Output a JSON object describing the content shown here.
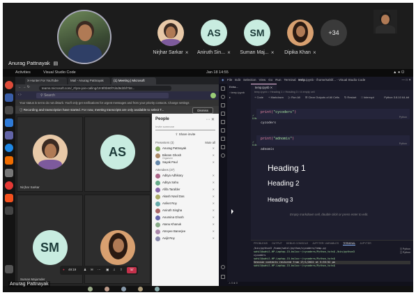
{
  "gallery": {
    "host_name": "Anurag Pattnayak",
    "participants": [
      {
        "name": "Nirjhar Sarkar",
        "initials": "",
        "color": "#e8c9a8"
      },
      {
        "name": "Aniruth Sin...",
        "initials": "AS",
        "color": "#c8ece0"
      },
      {
        "name": "Suman Maj...",
        "initials": "SM",
        "color": "#c8ece0"
      },
      {
        "name": "Dipika Khan",
        "initials": "",
        "color": "#d8a070"
      }
    ],
    "more_count": "+34"
  },
  "ubuntu": {
    "activities": "Activities",
    "app": "Visual Studio Code",
    "clock": "Jan 18  14:55"
  },
  "browser": {
    "tabs": [
      "X-Hunter For YouTube",
      "Mail - Anurag Pattnayak",
      "(1) Meeting | Microsoft"
    ],
    "url": "teams.microsoft.com/_#/pre-join-calling/19:8f0b90f7d4d9d2bf7b8...",
    "search_placeholder": "Search",
    "notice_1": "Your status is set to do not disturb. You'll only get notifications for urgent messages and from your priority contacts. Change settings",
    "notice_2": "Recording and transcription have started. For now, meeting transcripts are only available to select T...",
    "dismiss": "Dismiss",
    "tiles": [
      {
        "label": "Nirjhar Sarkar",
        "initials": ""
      },
      {
        "label": "",
        "initials": "AS"
      },
      {
        "label": "Suman Majumder",
        "initials": "SM"
      },
      {
        "label": "",
        "initials": ""
      }
    ],
    "call_timer": "49:19",
    "people": {
      "title": "People",
      "invite_placeholder": "Invite someone",
      "share_invite": "Share invite",
      "presenters_header": "Presenters (3)",
      "mute_all": "Mute all",
      "presenters": [
        {
          "name": "Anurag Pattnayak",
          "sub": ""
        },
        {
          "name": "Bikram Ghosh",
          "sub": "Organizer"
        },
        {
          "name": "Sayak Paul",
          "sub": ""
        }
      ],
      "attendees_header": "Attendees (37)",
      "attendees": [
        "Aditya Adhikary",
        "Aditya Sahu",
        "Afifa Tarafder",
        "Akash Nasil Das",
        "Aniket Roy",
        "Aniruth Singha",
        "Anumina Ghosh",
        "Atanu Khanuk",
        "Atreyee Banerjee",
        "Avijit Roy"
      ]
    }
  },
  "vscode": {
    "menu": [
      "File",
      "Edit",
      "Selection",
      "View",
      "Go",
      "Run",
      "Terminal",
      "Help"
    ],
    "title": "temp.ipynb - /home/sahil/... - Visual Studio Code",
    "explorer_label": "Extra...",
    "tab": "temp.ipynb",
    "breadcrumb": "temp.ipynb > Heading 1 > Heading 3 > # empty cell",
    "toolbar": [
      "+ Code",
      "+ Markdown",
      "▷ Run All",
      "☰ Clear Outputs of All Cells",
      "↻ Restart",
      "□ Interrupt"
    ],
    "kernel": "Python 3.8.10 64-bit",
    "cells": [
      {
        "code_fn": "print",
        "code_arg": "\"cycoders\"",
        "exec": "0.9s",
        "lang": "Python",
        "output": "cycoders"
      },
      {
        "code_fn": "print",
        "code_arg": "\"adnomis\"",
        "exec": "0.4s",
        "lang": "Python",
        "output": "adnomis"
      }
    ],
    "headings": [
      "Heading 1",
      "Heading 2",
      "Heading 3"
    ],
    "empty_hint": "Empty markdown cell, double click or press enter to edit.",
    "panel_tabs": [
      "PROBLEMS",
      "OUTPUT",
      "DEBUG CONSOLE",
      "JUPYTER: VARIABLES",
      "TERMINAL",
      "JUPYTER"
    ],
    "terminal": [
      "/bin/python3 /home/sahil/python/cycoders/temp.py",
      "sahil@sahil-HP-Laptop-15-bs1xx:~/cycoders/Python_tuts$ /bin/python3",
      "cycoders",
      "sahil@sahil-HP-Laptop-15-bs1xx:~/cycoders/Python_tuts$",
      "Session contents restored from 17/1/2022 at 5:55:52 pm",
      "sahil@sahil-HP-Laptop-15-bs1xx:~/cycoders/Python_tuts$"
    ],
    "terminal_list": [
      "Python",
      "Python"
    ]
  },
  "bottom": {
    "host_name": "Anurag Pattnayak"
  },
  "colors": {
    "teams_purple": "#464775",
    "leave_red": "#c4314b",
    "vscode_bg": "#1e1e2e"
  }
}
